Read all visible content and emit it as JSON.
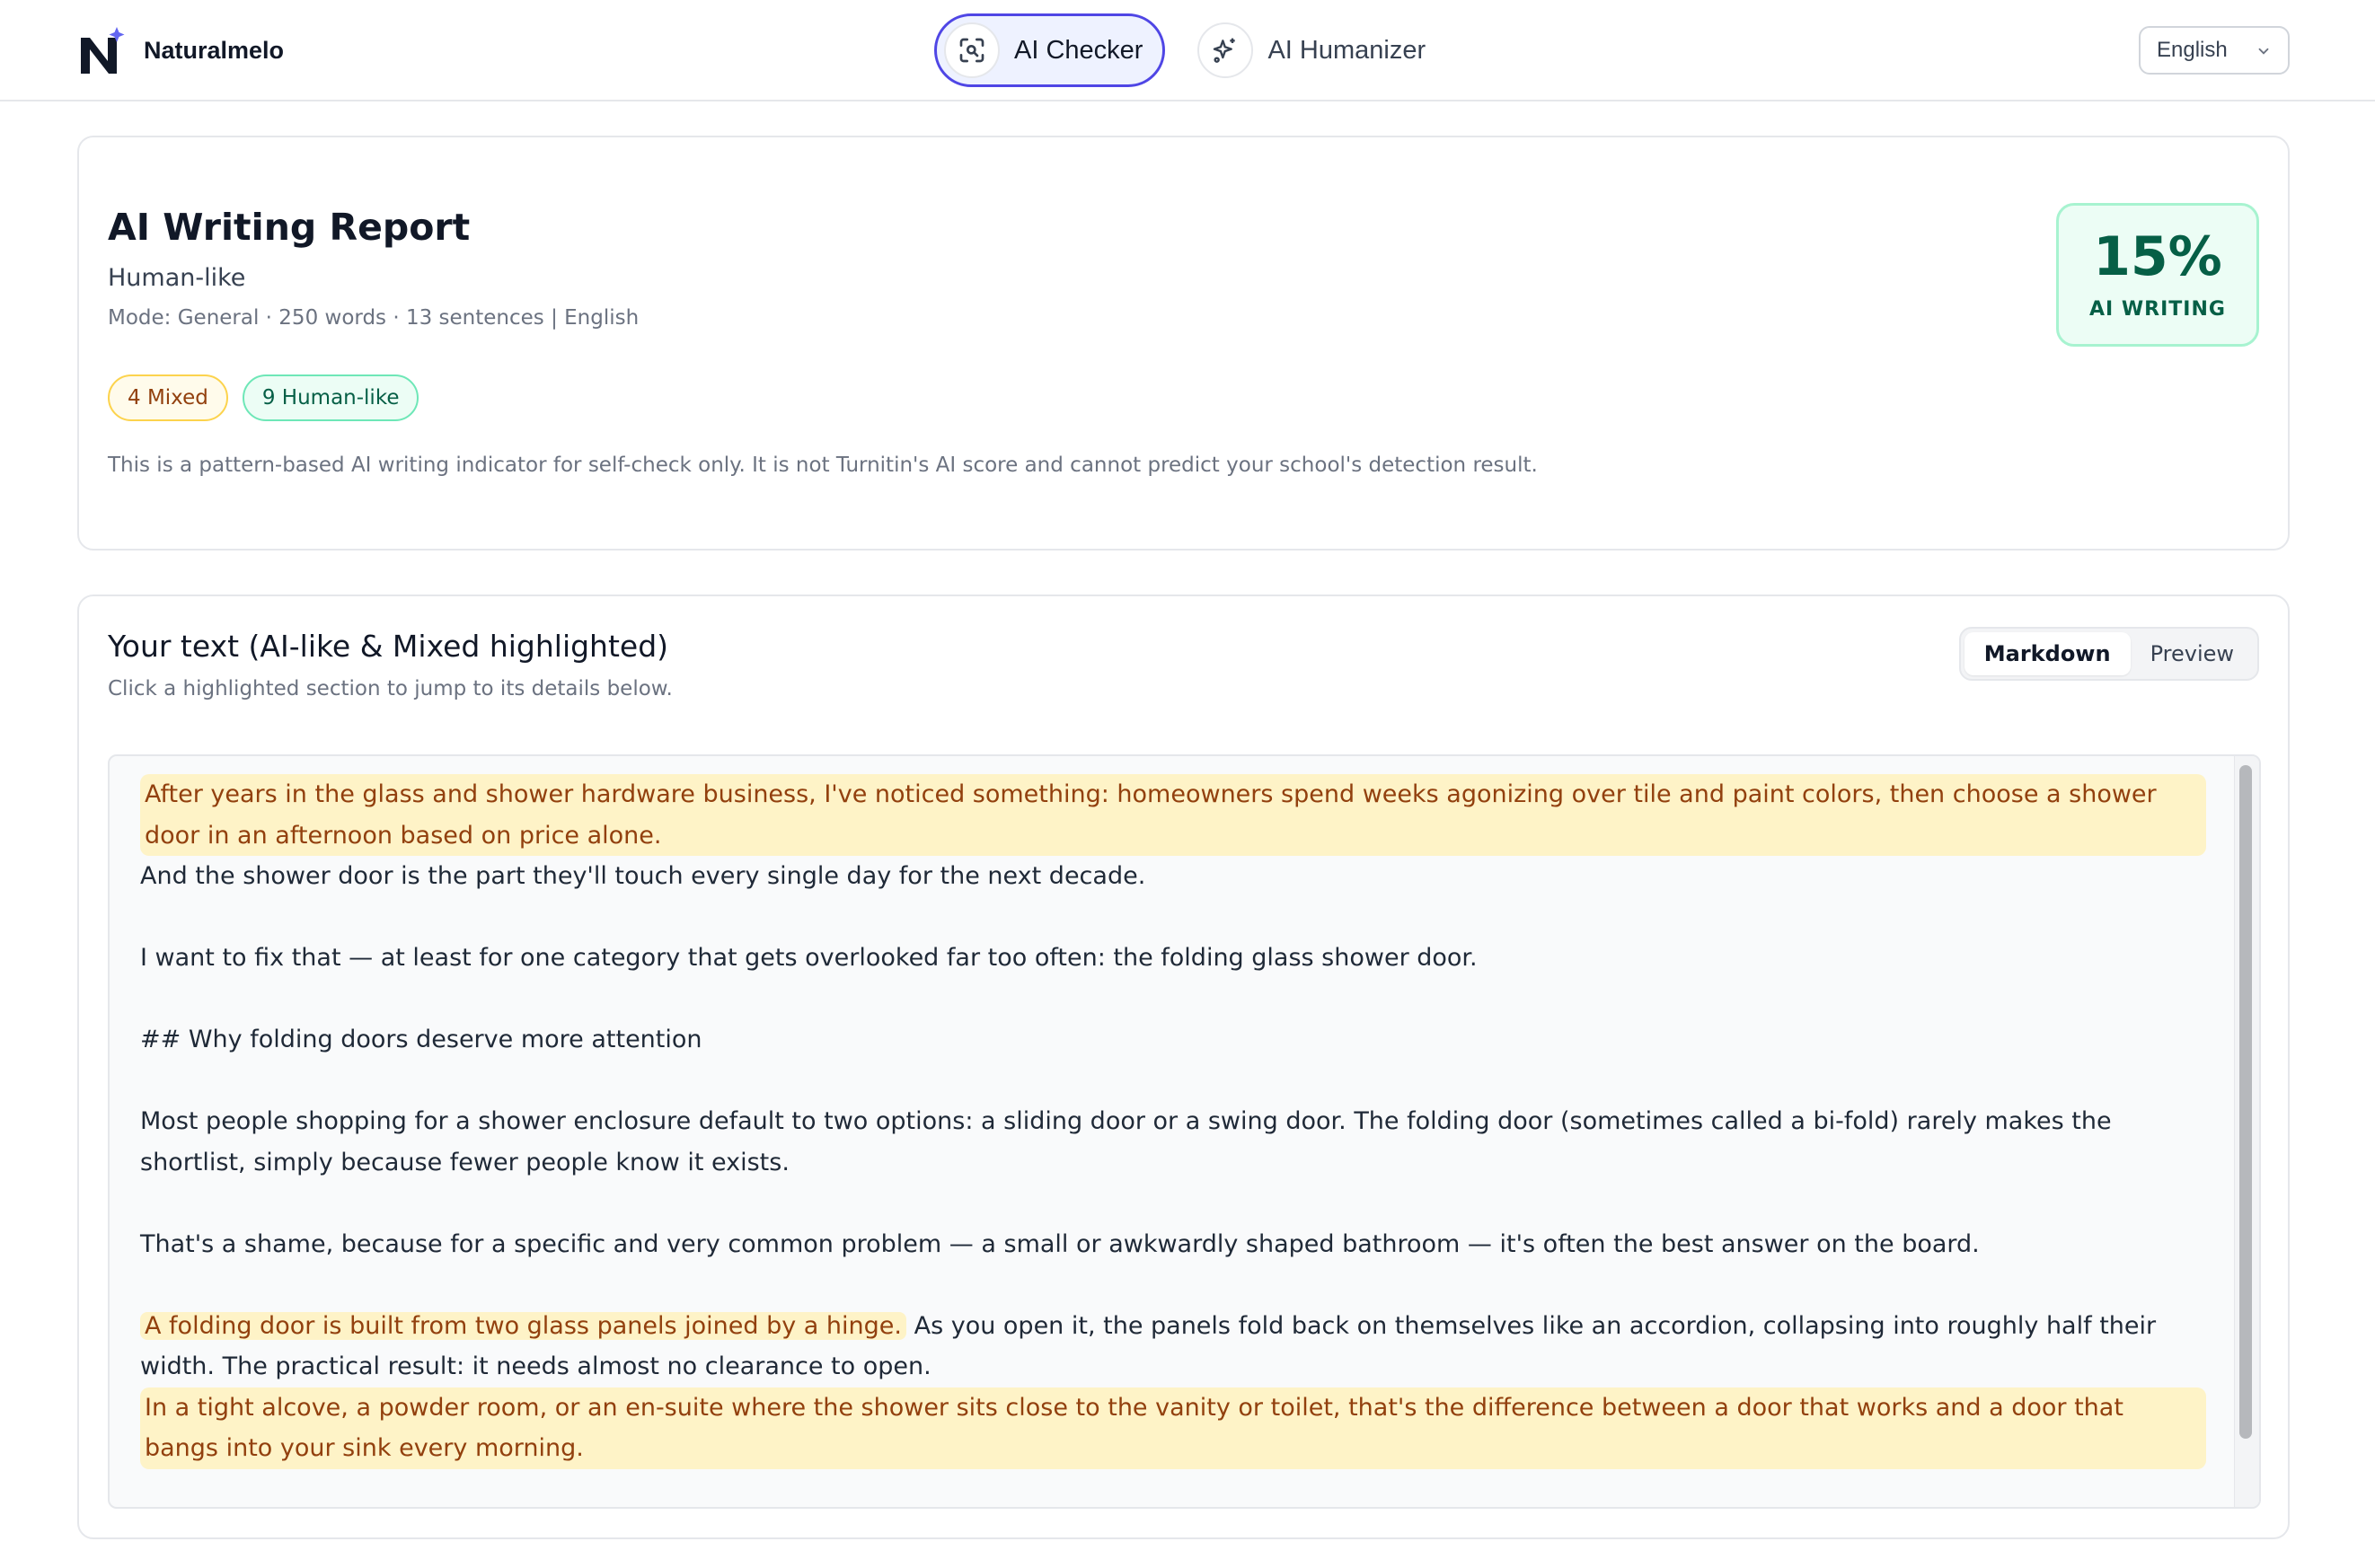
{
  "header": {
    "brand_name": "Naturalmelo",
    "nav": [
      {
        "label": "AI Checker",
        "icon": "scan-search-icon",
        "active": true
      },
      {
        "label": "AI Humanizer",
        "icon": "sparkles-icon",
        "active": false
      }
    ],
    "language": "English"
  },
  "report": {
    "title": "AI Writing Report",
    "verdict": "Human-like",
    "meta": "Mode: General · 250 words · 13 sentences | English",
    "chips": {
      "mixed": "4 Mixed",
      "human": "9 Human-like"
    },
    "disclaimer": "This is a pattern-based AI writing indicator for self-check only. It is not Turnitin's AI score and cannot predict your school's detection result.",
    "score_value": "15%",
    "score_label": "AI WRITING"
  },
  "text_section": {
    "title": "Your text (AI-like & Mixed highlighted)",
    "subtitle": "Click a highlighted section to jump to its details below.",
    "view_modes": [
      "Markdown",
      "Preview"
    ],
    "active_view": "Markdown",
    "paragraphs": {
      "p1_hl": "After years in the glass and shower hardware business, I've noticed something: homeowners spend weeks agonizing over tile and paint colors, then choose a shower door in an afternoon based on price alone.",
      "p1_rest": "And the shower door is the part they'll touch every single day for the next decade.",
      "p2": "I want to fix that — at least for one category that gets overlooked far too often: the folding glass shower door.",
      "p3": "## Why folding doors deserve more attention",
      "p4": "Most people shopping for a shower enclosure default to two options: a sliding door or a swing door. The folding door (sometimes called a bi-fold) rarely makes the shortlist, simply because fewer people know it exists.",
      "p5": "That's a shame, because for a specific and very common problem — a small or awkwardly shaped bathroom — it's often the best answer on the board.",
      "p6_hl": "A folding door is built from two glass panels joined by a hinge.",
      "p6_rest": "As you open it, the panels fold back on themselves like an accordion, collapsing into roughly half their width. The practical result: it needs almost no clearance to open.",
      "p7_hl": "In a tight alcove, a powder room, or an en-suite where the shower sits close to the vanity or toilet, that's the difference between a door that works and a door that bangs into your sink every morning."
    }
  },
  "colors": {
    "accent": "#4f46e5",
    "mixed_highlight": "#fef3c7",
    "human_green": "#065f46"
  }
}
